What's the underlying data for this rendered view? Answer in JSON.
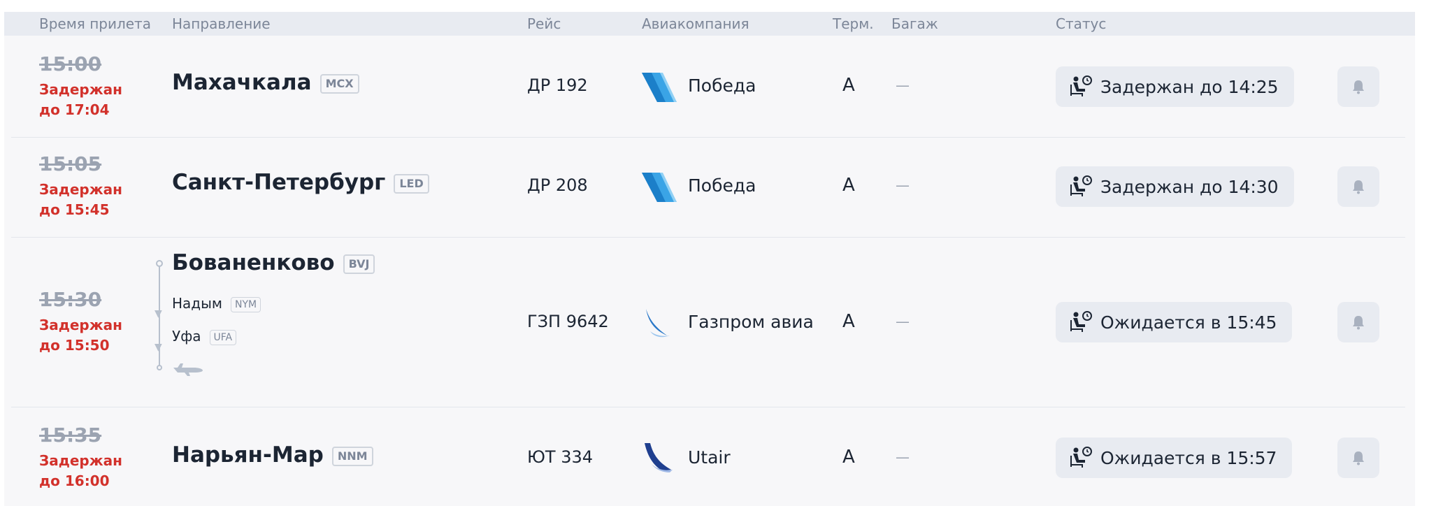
{
  "columns": {
    "arrival_time": "Время прилета",
    "direction": "Направление",
    "flight": "Рейс",
    "airline": "Авиакомпания",
    "terminal": "Терм.",
    "baggage": "Багаж",
    "status": "Статус"
  },
  "flights": [
    {
      "scheduled": "15:00",
      "delay_line1": "Задержан",
      "delay_line2": "до 17:04",
      "city": "Махачкала",
      "code": "MCX",
      "flight": "ДР 192",
      "airline": "Победа",
      "airline_logo": "pobeda-logo",
      "terminal": "A",
      "baggage": "—",
      "status": "Задержан до 14:25"
    },
    {
      "scheduled": "15:05",
      "delay_line1": "Задержан",
      "delay_line2": "до 15:45",
      "city": "Санкт-Петербург",
      "code": "LED",
      "flight": "ДР 208",
      "airline": "Победа",
      "airline_logo": "pobeda-logo",
      "terminal": "A",
      "baggage": "—",
      "status": "Задержан до 14:30"
    },
    {
      "scheduled": "15:30",
      "delay_line1": "Задержан",
      "delay_line2": "до 15:50",
      "city": "Бованенково",
      "code": "BVJ",
      "stops": [
        {
          "city": "Надым",
          "code": "NYM"
        },
        {
          "city": "Уфа",
          "code": "UFA"
        }
      ],
      "flight": "ГЗП 9642",
      "airline": "Газпром авиа",
      "airline_logo": "gazprom-avia-logo",
      "terminal": "A",
      "baggage": "—",
      "status": "Ожидается в 15:45"
    },
    {
      "scheduled": "15:35",
      "delay_line1": "Задержан",
      "delay_line2": "до 16:00",
      "city": "Нарьян-Мар",
      "code": "NNM",
      "flight": "ЮТ 334",
      "airline": "Utair",
      "airline_logo": "utair-logo",
      "terminal": "A",
      "baggage": "—",
      "status": "Ожидается в 15:57"
    }
  ],
  "icons": {
    "status": "waiting-passenger-icon",
    "subscribe": "bell-icon",
    "route_end": "plane-icon"
  },
  "colors": {
    "delay_red": "#d2312b",
    "header_bg": "#e8ebf1",
    "muted_text": "#7c8698"
  }
}
